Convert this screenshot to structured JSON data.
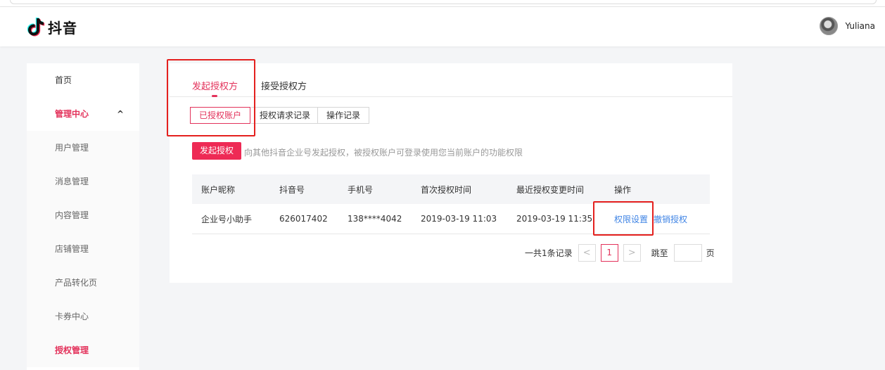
{
  "app": {
    "logo_text": "抖音",
    "user_name": "Yuliana"
  },
  "sidebar": {
    "items": [
      {
        "label": "首页"
      },
      {
        "label": "管理中心"
      },
      {
        "label": "用户管理"
      },
      {
        "label": "消息管理"
      },
      {
        "label": "内容管理"
      },
      {
        "label": "店铺管理"
      },
      {
        "label": "产品转化页"
      },
      {
        "label": "卡券中心"
      },
      {
        "label": "授权管理"
      }
    ],
    "expanded_chevron": "^"
  },
  "tabs": [
    {
      "label": "发起授权方"
    },
    {
      "label": "接受授权方"
    }
  ],
  "segments": [
    {
      "label": "已授权账户"
    },
    {
      "label": "授权请求记录"
    },
    {
      "label": "操作记录"
    }
  ],
  "actions": {
    "primary_label": "发起授权",
    "hint": "向其他抖音企业号发起授权，被授权账户可登录使用您当前账户的功能权限"
  },
  "table": {
    "headers": [
      "账户昵称",
      "抖音号",
      "手机号",
      "首次授权时间",
      "最近授权变更时间",
      "操作"
    ],
    "rows": [
      {
        "nickname": "企业号小助手",
        "douyin_id": "626017402",
        "phone": "138****4042",
        "first_auth": "2019-03-19 11:03",
        "last_change": "2019-03-19 11:35",
        "op_settings": "权限设置",
        "op_revoke": "撤销授权"
      }
    ]
  },
  "pagination": {
    "total": "一共1条记录",
    "prev": "<",
    "current": "1",
    "next": ">",
    "jump_label": "跳至",
    "page_label": "页"
  },
  "colors": {
    "accent": "#e3325b",
    "link": "#3f84e5",
    "annotation": "#e4201e"
  }
}
